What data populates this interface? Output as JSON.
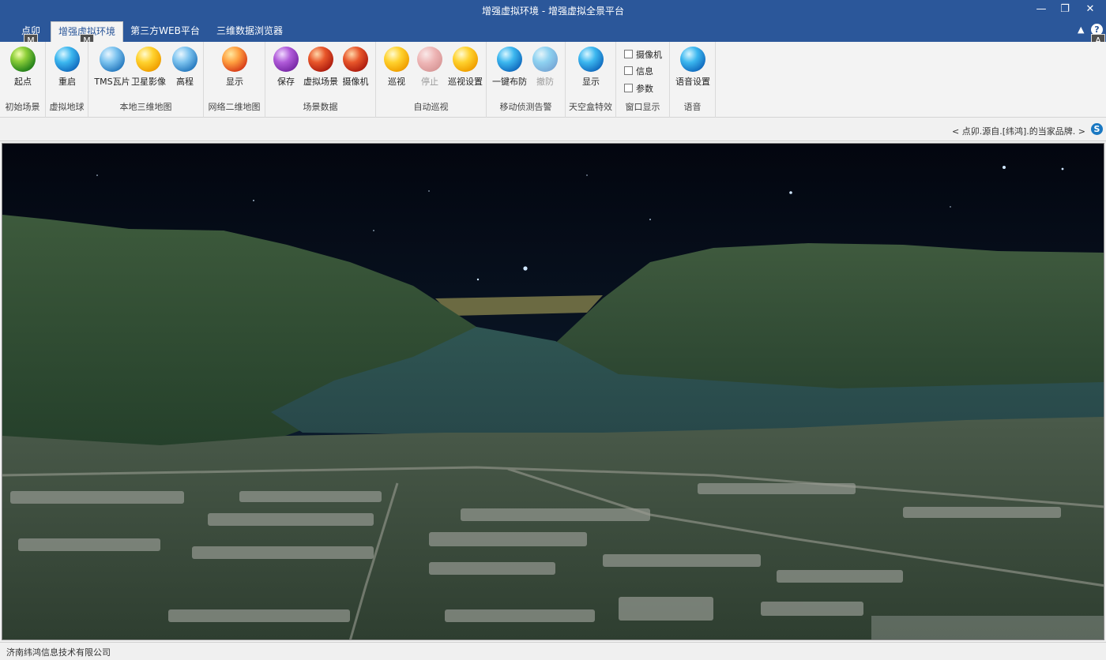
{
  "window": {
    "title": "增强虚拟环境 - 增强虚拟全景平台",
    "min_glyph": "—",
    "restore_glyph": "❐",
    "close_glyph": "✕"
  },
  "tabs": [
    {
      "label": "点卯",
      "keytip": "M"
    },
    {
      "label": "增强虚拟环境",
      "keytip": "M",
      "active": true
    },
    {
      "label": "第三方WEB平台"
    },
    {
      "label": "三维数据浏览器"
    }
  ],
  "help": {
    "glyph": "?",
    "keytip": "A",
    "collapse_glyph": "▲"
  },
  "ribbon": {
    "groups": [
      {
        "label": "初始场景",
        "buttons": [
          {
            "label": "起点",
            "icon": "globe-green-icon"
          }
        ]
      },
      {
        "label": "虚拟地球",
        "buttons": [
          {
            "label": "重启",
            "icon": "globe-blue-icon"
          }
        ]
      },
      {
        "label": "本地三维地图",
        "buttons": [
          {
            "label": "TMS瓦片",
            "icon": "tms-tiles-icon"
          },
          {
            "label": "卫星影像",
            "icon": "satellite-icon"
          },
          {
            "label": "高程",
            "icon": "elevation-icon"
          }
        ]
      },
      {
        "label": "网络二维地图",
        "buttons": [
          {
            "label": "显示",
            "icon": "web-map-icon"
          }
        ]
      },
      {
        "label": "场景数据",
        "buttons": [
          {
            "label": "保存",
            "icon": "save-scene-icon"
          },
          {
            "label": "虚拟场景",
            "icon": "virtual-scene-icon"
          },
          {
            "label": "摄像机",
            "icon": "camera-icon"
          }
        ]
      },
      {
        "label": "自动巡视",
        "buttons": [
          {
            "label": "巡视",
            "icon": "patrol-icon"
          },
          {
            "label": "停止",
            "icon": "stop-icon",
            "disabled": true
          },
          {
            "label": "巡视设置",
            "icon": "patrol-settings-icon"
          }
        ]
      },
      {
        "label": "移动侦测告警",
        "buttons": [
          {
            "label": "一键布防",
            "icon": "arm-icon"
          },
          {
            "label": "撤防",
            "icon": "disarm-icon",
            "disabled": true
          }
        ]
      },
      {
        "label": "天空盒特效",
        "buttons": [
          {
            "label": "显示",
            "icon": "skybox-icon"
          }
        ]
      },
      {
        "label": "窗口显示",
        "checkboxes": [
          "摄像机",
          "信息",
          "参数"
        ]
      },
      {
        "label": "语音",
        "buttons": [
          {
            "label": "语音设置",
            "icon": "voice-settings-icon"
          }
        ]
      }
    ]
  },
  "infobar": {
    "text": "<  点卯.源自.[纬鸿].的当家品牌.  >",
    "logo": "S"
  },
  "status": {
    "text": "济南纬鸿信息技术有限公司"
  },
  "colors": {
    "titlebar": "#2b579a",
    "ribbon": "#f3f3f3"
  }
}
